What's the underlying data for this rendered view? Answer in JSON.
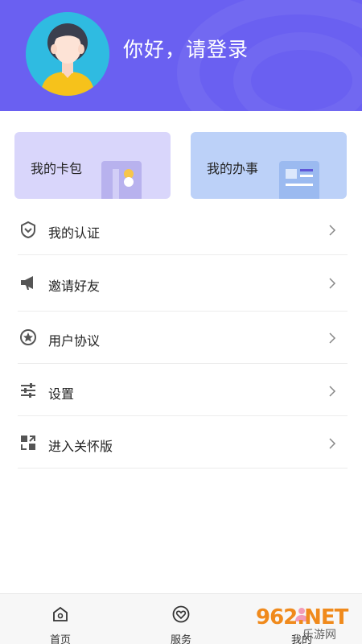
{
  "header": {
    "greeting": "你好，请登录",
    "avatar_icon": "user-avatar-icon",
    "bg_color": "#6a60f1"
  },
  "cards": [
    {
      "label": "我的卡包",
      "icon": "card-wallet-icon",
      "bg_color": "#d9d6fb"
    },
    {
      "label": "我的办事",
      "icon": "document-icon",
      "bg_color": "#bcd1f8"
    }
  ],
  "menu": [
    {
      "label": "我的认证",
      "icon": "verify-badge-icon"
    },
    {
      "label": "邀请好友",
      "icon": "megaphone-icon"
    },
    {
      "label": "用户协议",
      "icon": "star-circle-icon"
    },
    {
      "label": "设置",
      "icon": "sliders-icon"
    },
    {
      "label": "进入关怀版",
      "icon": "care-mode-icon"
    }
  ],
  "tabbar": [
    {
      "label": "首页",
      "icon": "home-icon"
    },
    {
      "label": "服务",
      "icon": "heart-circle-icon"
    },
    {
      "label": "我的",
      "icon": "user-icon"
    }
  ],
  "watermark": {
    "logo_text": "962.NET",
    "sub_text": "乐游网"
  }
}
